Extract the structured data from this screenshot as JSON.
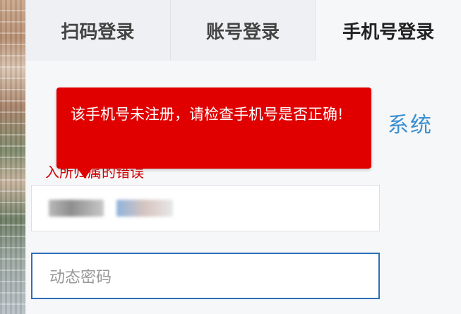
{
  "tabs": [
    {
      "label": "扫码登录"
    },
    {
      "label": "账号登录"
    },
    {
      "label": "手机号登录"
    }
  ],
  "title_partial": "系统",
  "hint_text": "入所归属的错误",
  "phone_input": {
    "value": ""
  },
  "password_input": {
    "placeholder": "动态密码"
  },
  "error_tooltip": {
    "message": "该手机号未注册，请检查手机号是否正确!"
  },
  "colors": {
    "accent": "#2f6fb8",
    "error": "#e00000",
    "title": "#3a8fd0"
  }
}
